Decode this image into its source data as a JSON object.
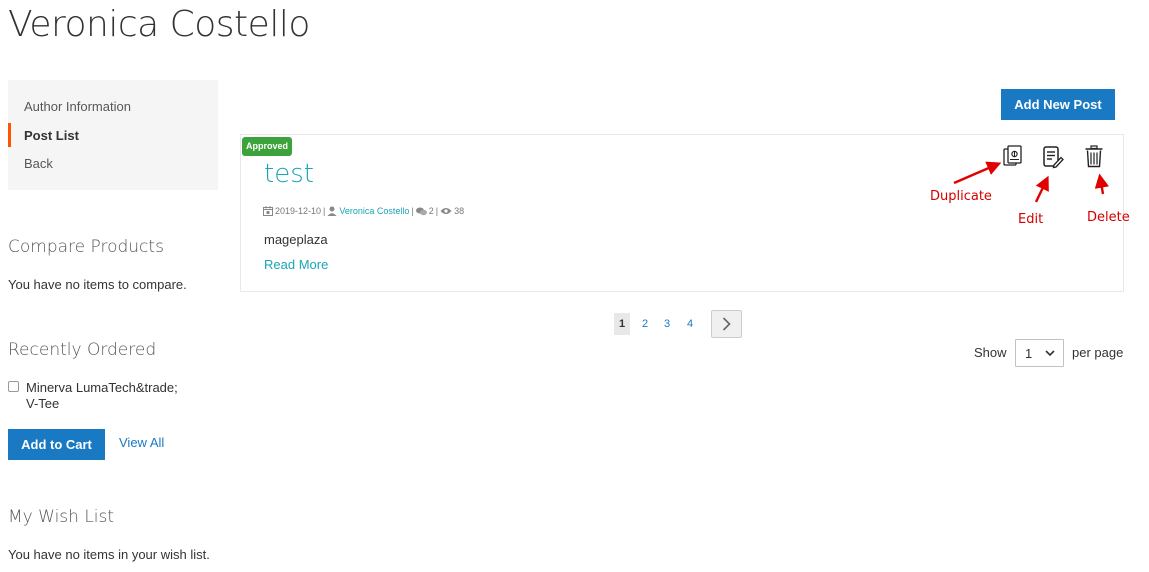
{
  "page": {
    "title": "Veronica Costello"
  },
  "sidebar": {
    "nav": [
      {
        "label": "Author Information",
        "active": false
      },
      {
        "label": "Post List",
        "active": true
      },
      {
        "label": "Back",
        "active": false
      }
    ],
    "compare": {
      "heading": "Compare Products",
      "empty_text": "You have no items to compare."
    },
    "recently_ordered": {
      "heading": "Recently Ordered",
      "item_line1": "Minerva LumaTech&trade;",
      "item_line2": "V-Tee",
      "add_to_cart": "Add to Cart",
      "view_all": "View All"
    },
    "wishlist": {
      "heading": "My Wish List",
      "empty_text": "You have no items in your wish list."
    }
  },
  "toolbar": {
    "add_new_post": "Add New Post"
  },
  "post": {
    "badge": "Approved",
    "title": "test",
    "date": "2019-12-10",
    "author": "Veronica Costello",
    "comments": "2",
    "views": "38",
    "excerpt": "mageplaza",
    "read_more": "Read More",
    "sep": "|"
  },
  "annotations": {
    "duplicate": "Duplicate",
    "edit": "Edit",
    "delete": "Delete"
  },
  "pagination": {
    "pages": [
      "1",
      "2",
      "3",
      "4"
    ],
    "current": "1"
  },
  "limiter": {
    "show_label": "Show",
    "value": "1",
    "per_page": "per page"
  },
  "colors": {
    "accent": "#1979c3",
    "teal": "#1aa6b7",
    "approved": "#3ca33c",
    "nav_active": "#ff5501",
    "annotation": "#d40000"
  }
}
